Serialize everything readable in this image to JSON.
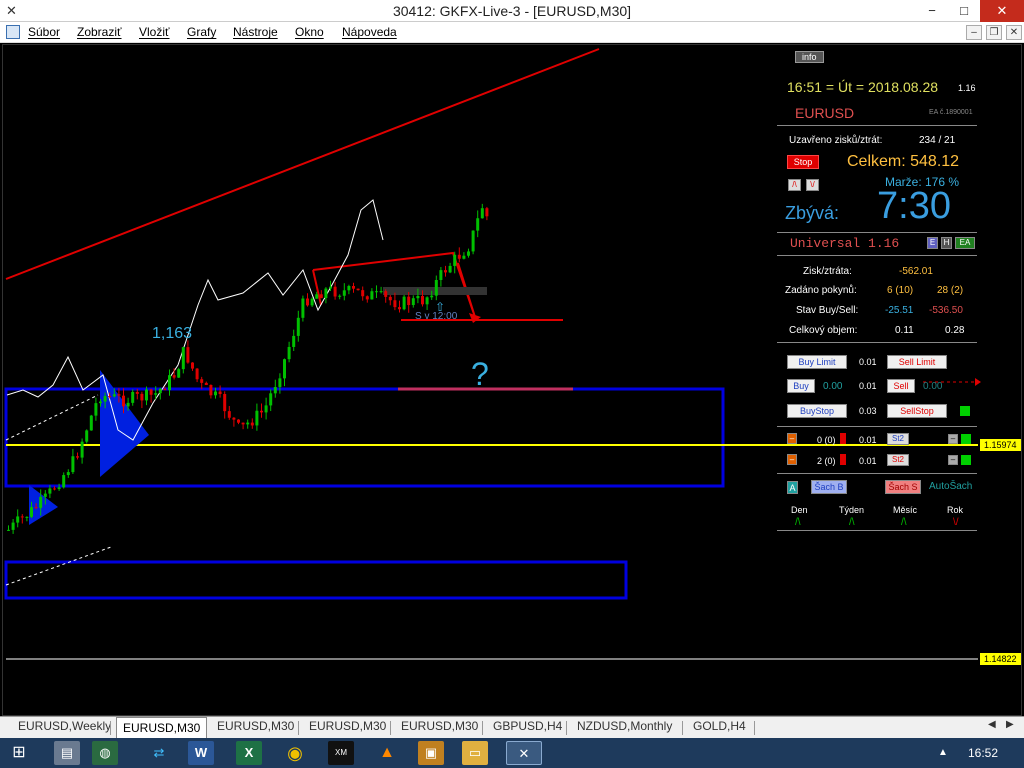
{
  "window": {
    "title": "30412: GKFX-Live-3 - [EURUSD,M30]",
    "minimize": "−",
    "maximize": "□",
    "close": "✕"
  },
  "menu": [
    "Súbor",
    "Zobraziť",
    "Vložiť",
    "Grafy",
    "Nástroje",
    "Okno",
    "Nápoveda"
  ],
  "chart": {
    "annotation_value": "1,163",
    "question_mark": "?",
    "price_levels": [
      "1.15974",
      "1.14822"
    ],
    "order_text": "S v 12:00"
  },
  "panel": {
    "info_button": "info",
    "clock": "16:51 = Út = 2018.08.28",
    "version_small": "1.16",
    "symbol": "EURUSD",
    "ea_number": "EA č.1890001",
    "closed_label": "Uzavřeno zisků/ztrát:",
    "closed_value": "234 / 21",
    "stop_button": "Stop",
    "total_label": "Celkem: 548.12",
    "margin_label": "Marže:  176 %",
    "remaining_label": "Zbývá:",
    "remaining_time": "7:30",
    "universal": "Universal 1.16",
    "badges": [
      "E",
      "H",
      "EA"
    ],
    "profit_label": "Zisk/ztráta:",
    "profit_value": "-562.01",
    "orders_label": "Zadáno pokynů:",
    "orders_buy": "6 (10)",
    "orders_sell": "28 (2)",
    "state_label": "Stav Buy/Sell:",
    "state_buy": "-25.51",
    "state_sell": "-536.50",
    "volume_label": "Celkový objem:",
    "volume_buy": "0.11",
    "volume_sell": "0.28",
    "buy_limit": "Buy Limit",
    "buy_limit_lot": "0.01",
    "sell_limit": "Sell Limit",
    "buy": "Buy",
    "buy_value": "0.00",
    "buy_lot": "0.01",
    "sell": "Sell",
    "sell_value": "0.00",
    "buy_stop": "BuyStop",
    "buy_stop_lot": "0.03",
    "sell_stop": "SellStop",
    "row1_count": "0 (0)",
    "row1_lot": "0.01",
    "row1_btn": "St2",
    "row2_count": "2 (0)",
    "row2_lot": "0.01",
    "row2_btn": "St2",
    "a_button": "A",
    "sach_b": "Šach B",
    "sach_s": "Šach S",
    "autosach": "AutoŠach",
    "periods": [
      "Den",
      "Týden",
      "Měsíc",
      "Rok"
    ],
    "period_marks": [
      "/\\",
      "/\\",
      "/\\",
      "\\/"
    ]
  },
  "tabs": [
    "EURUSD,Weekly",
    "EURUSD,M30",
    "EURUSD,M30",
    "EURUSD,M30",
    "EURUSD,M30",
    "GBPUSD,H4",
    "NZDUSD,Monthly",
    "GOLD,H4"
  ],
  "active_tab_index": 1,
  "taskbar": {
    "time": "16:52",
    "icons": [
      "windows-start",
      "file-explorer",
      "globe",
      "arrows",
      "word",
      "excel",
      "chrome",
      "xm",
      "vlc",
      "gkfx",
      "folder",
      "mt4"
    ]
  },
  "colors": {
    "bull": "#00c000",
    "bear": "#e00000",
    "trendline": "#e00000",
    "zone": "#0000e0",
    "price_line": "#ffff00",
    "accent_cyan": "#3ab0e0",
    "total_gold": "#ffc040",
    "remaining_blue": "#3a9ee0"
  }
}
